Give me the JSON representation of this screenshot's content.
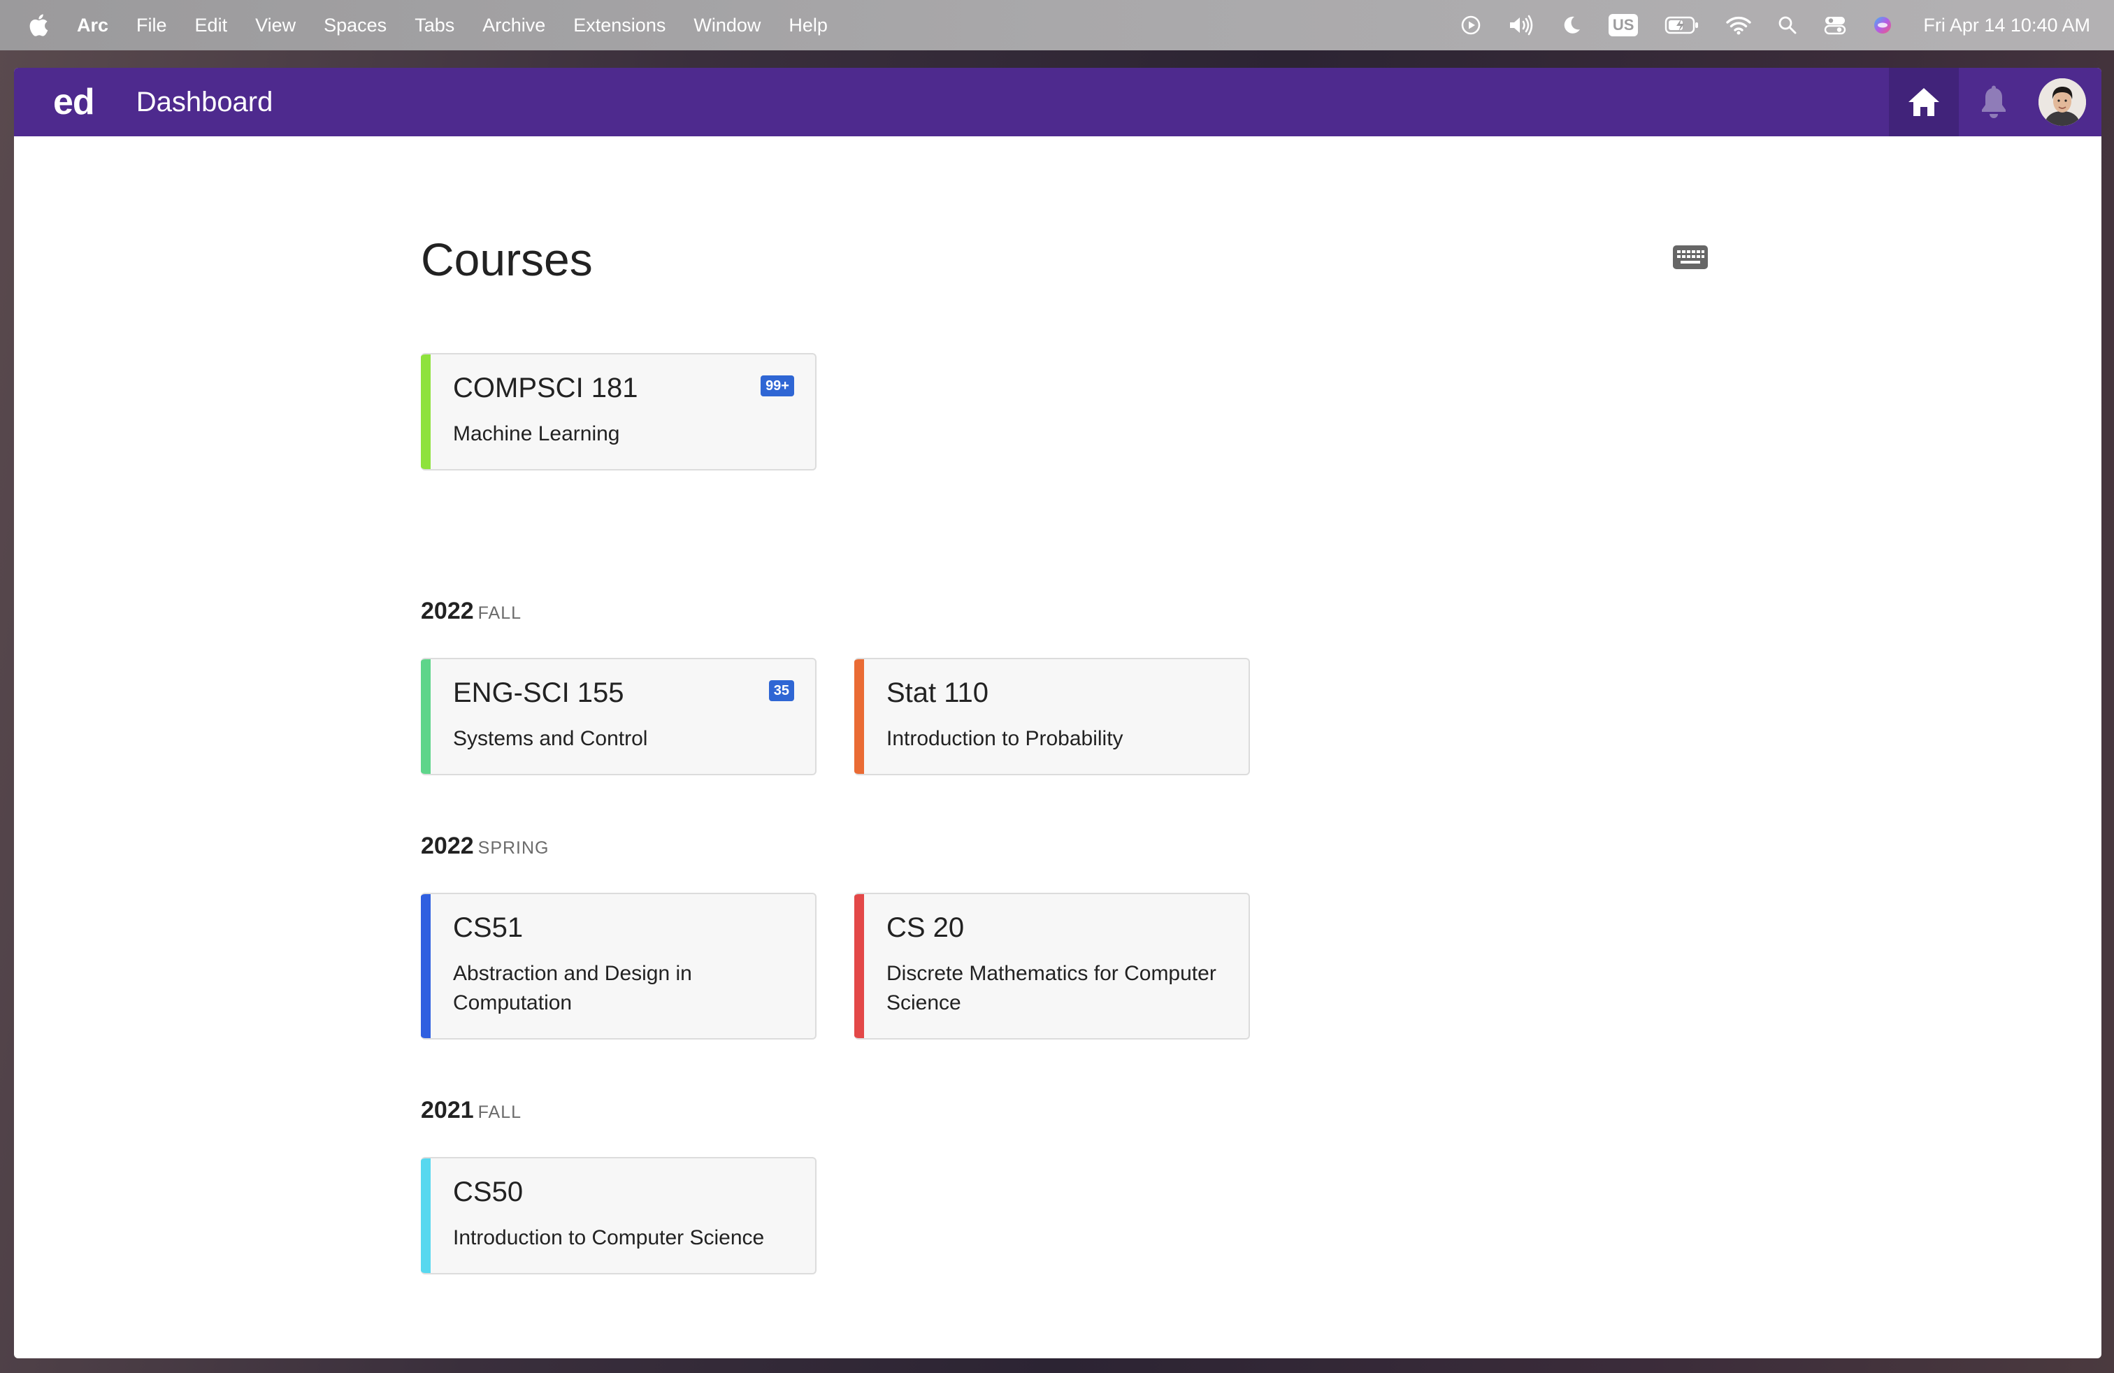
{
  "menubar": {
    "app_name": "Arc",
    "items": [
      "File",
      "Edit",
      "View",
      "Spaces",
      "Tabs",
      "Archive",
      "Extensions",
      "Window",
      "Help"
    ],
    "input_source": "US",
    "clock": "Fri Apr 14  10:40 AM"
  },
  "topbar": {
    "logo": "ed",
    "title": "Dashboard",
    "accent_color": "#4e2a8e"
  },
  "main": {
    "heading": "Courses",
    "pinned_courses": [
      {
        "code": "COMPSCI 181",
        "name": "Machine Learning",
        "badge": "99+",
        "color": "#8ee23c"
      }
    ],
    "terms": [
      {
        "year": "2022",
        "season": "FALL",
        "courses": [
          {
            "code": "ENG-SCI 155",
            "name": "Systems and Control",
            "badge": "35",
            "color": "#5ed58a"
          },
          {
            "code": "Stat 110",
            "name": "Introduction to Probability",
            "badge": "",
            "color": "#ea6b34"
          }
        ]
      },
      {
        "year": "2022",
        "season": "SPRING",
        "courses": [
          {
            "code": "CS51",
            "name": "Abstraction and Design in Computation",
            "badge": "",
            "color": "#2f5fe0"
          },
          {
            "code": "CS 20",
            "name": "Discrete Mathematics for Computer Science",
            "badge": "",
            "color": "#e34848"
          }
        ]
      },
      {
        "year": "2021",
        "season": "FALL",
        "courses": [
          {
            "code": "CS50",
            "name": "Introduction to Computer Science",
            "badge": "",
            "color": "#57d8ef"
          }
        ]
      }
    ]
  }
}
